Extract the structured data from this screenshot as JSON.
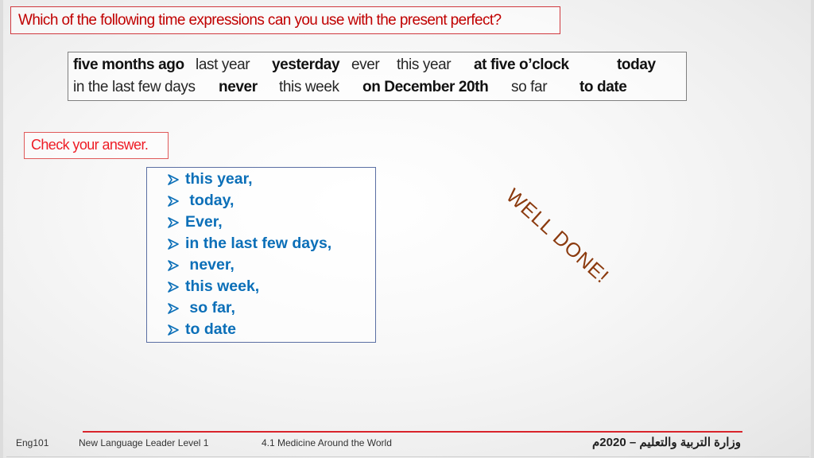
{
  "title": "Which of the following time expressions can you use with the present perfect?",
  "options": {
    "row1": [
      {
        "text": "five months ago",
        "bold": true
      },
      {
        "text": "last year",
        "bold": false
      },
      {
        "text": "yesterday",
        "bold": true
      },
      {
        "text": "ever",
        "bold": false
      },
      {
        "text": "this year",
        "bold": false
      },
      {
        "text": "at five o’clock",
        "bold": true
      },
      {
        "text": "today",
        "bold": true
      }
    ],
    "row2": [
      {
        "text": "in the last few days",
        "bold": false
      },
      {
        "text": "never",
        "bold": true
      },
      {
        "text": "this week",
        "bold": false
      },
      {
        "text": "on December 20th",
        "bold": true
      },
      {
        "text": "so far",
        "bold": false
      },
      {
        "text": "to date",
        "bold": true
      }
    ]
  },
  "check_label": "Check your answer.",
  "answers": [
    "this year,",
    " today,",
    "Ever,",
    "in the last few days,",
    " never,",
    "this week,",
    " so far,",
    "to date"
  ],
  "bullet_icon": "arrow-bullet-icon",
  "feedback": "WELL DONE!",
  "footer": {
    "course": "Eng101",
    "book": "New Language Leader Level 1",
    "unit": "4.1 Medicine Around the World",
    "ministry": "وزارة التربية والتعليم – 2020م"
  },
  "colors": {
    "title_red": "#c00000",
    "check_red": "#ee1c25",
    "answer_blue": "#0b6fb8",
    "feedback_brown": "#8b3a0e",
    "footer_line": "#d9242b"
  }
}
